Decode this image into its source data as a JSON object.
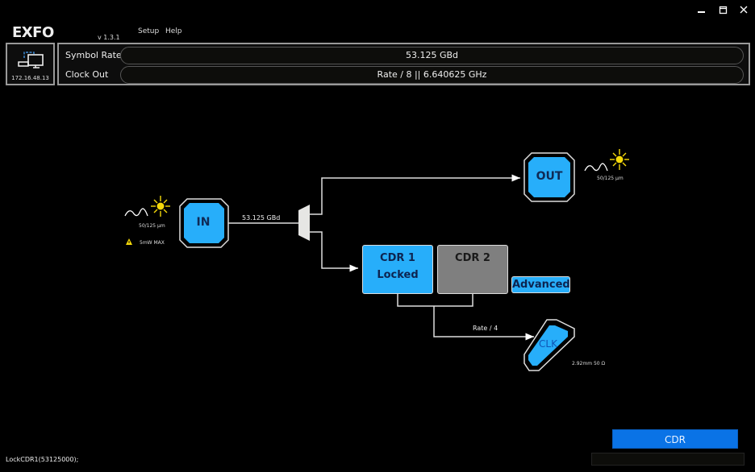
{
  "window": {
    "controls": [
      "minimize",
      "maximize",
      "close"
    ]
  },
  "header": {
    "logo": "EXFO",
    "version": "v 1.3.1",
    "menu": [
      {
        "label": "Setup"
      },
      {
        "label": "Help"
      }
    ]
  },
  "device": {
    "icon": "network-computer-icon",
    "ip": "172.16.48.13"
  },
  "parameters": {
    "symbol_rate_label": "Symbol Rate",
    "symbol_rate_value": "53.125 GBd",
    "clock_out_label": "Clock Out",
    "clock_out_value": "Rate / 8 || 6.640625 GHz"
  },
  "diagram": {
    "input": {
      "label": "IN",
      "fiber": "50/125 µm",
      "warning": "5mW MAX",
      "link_rate": "53.125 GBd"
    },
    "output": {
      "label": "OUT",
      "fiber": "50/125 µm"
    },
    "cdr1": {
      "title": "CDR 1",
      "status": "Locked"
    },
    "cdr2": {
      "title": "CDR 2",
      "status": ""
    },
    "advanced_label": "Advanced",
    "clock": {
      "label": "CLK",
      "rate": "Rate / 4",
      "connector": "2.92mm 50 Ω"
    }
  },
  "footer": {
    "mode_button": "CDR",
    "status_text": "LockCDR1(53125000);"
  },
  "colors": {
    "accent_blue": "#27aefa",
    "button_blue": "#0a73e6",
    "cdr_inactive": "#7f7f7f",
    "laser_yellow": "#f5d90a"
  }
}
